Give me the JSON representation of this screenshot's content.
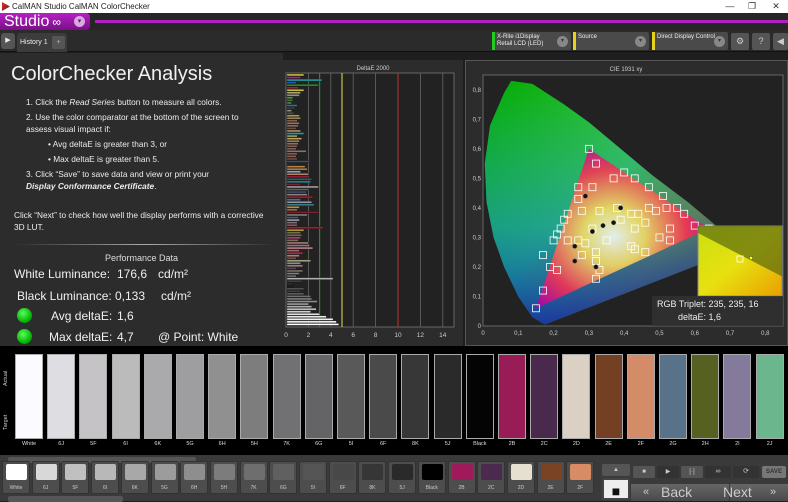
{
  "window": {
    "title": "CalMAN Studio CalMAN ColorChecker",
    "controls": [
      "—",
      "❐",
      "✕"
    ]
  },
  "studio": {
    "label": "Studio",
    "symbol": "∞",
    "dropdown": "▾"
  },
  "tabs": {
    "play": "▶",
    "history": "History 1",
    "add": "+"
  },
  "devices": [
    {
      "label": "X-Rite i1Display Retail LCD (LED)",
      "color": "#22cc22"
    },
    {
      "label": "Source",
      "color": "#e6d21a"
    },
    {
      "label": "Direct Display Control",
      "color": "#e6d21a"
    }
  ],
  "toolbar_icons": {
    "settings": "⚙",
    "help": "?",
    "back": "◀"
  },
  "analysis": {
    "title": "ColorChecker Analysis",
    "step1_pre": "1.  Click the ",
    "step1_em": "Read Series",
    "step1_post": " button to measure all colors.",
    "step2": "2.  Use the color comparator at the bottom of the screen to",
    "step2b": "assess visual impact if:",
    "bullet1": "•  Avg deltaE is greater than 3, or",
    "bullet2": "•  Max deltaE is greater than 5.",
    "step3": "3.  Click “Save” to save data and view or print your",
    "step3_em": "Display Conformance Certificate",
    "step3_end": ".",
    "next_note": "Click “Next” to check how well the display performs with a corrective",
    "next_note2": "3D LUT."
  },
  "performance": {
    "title": "Performance Data",
    "white_label": "White Luminance:",
    "white_value": "176,6",
    "white_unit": "cd/m²",
    "black_label": "Black Luminance:",
    "black_value": "0,133",
    "black_unit": "cd/m²",
    "avg_label": "Avg deltaE:",
    "avg_value": "1,6",
    "max_label": "Max deltaE:",
    "max_value": "4,7",
    "max_point": "@ Point: White"
  },
  "chart_data": [
    {
      "type": "bar",
      "title": "DeltaE 2000",
      "orientation": "horizontal",
      "xlim": [
        0,
        15
      ],
      "xticks": [
        "0",
        "2",
        "4",
        "6",
        "8",
        "10",
        "12",
        "14"
      ],
      "thresholds": [
        {
          "value": 3,
          "color": "#2a8a2a"
        },
        {
          "value": 5,
          "color": "#c8c040"
        },
        {
          "value": 10,
          "color": "#a03030"
        }
      ],
      "values": [
        1.6,
        1.3,
        3.2,
        0.9,
        2.9,
        1.1,
        1.6,
        1.3,
        1.2,
        0.6,
        0.6,
        0.5,
        1.0,
        0.8,
        0.5,
        0.7,
        1.2,
        1.3,
        1.0,
        1.2,
        1.1,
        0.9,
        1.3,
        1.6,
        1.0,
        1.4,
        1.2,
        1.1,
        1.0,
        0.9,
        1.8,
        1.0,
        0.9,
        1.0,
        2.1,
        0.9,
        1.7,
        1.9,
        1.3,
        2.0,
        2.1,
        2.3,
        2.2,
        1.3,
        2.9,
        2.0,
        1.8,
        1.9,
        2.4,
        1.3,
        2.3,
        2.5,
        1.2,
        1.0,
        2.9,
        1.9,
        1.1,
        1.2,
        1.0,
        1.0,
        3.3,
        1.6,
        1.3,
        1.4,
        1.3,
        1.1,
        2.0,
        2.1,
        2.4,
        1.2,
        1.5,
        1.2,
        0.9,
        2.2,
        1.3,
        1.5,
        0.9,
        1.5,
        1.2,
        0.9,
        4.2,
        1.4,
        0.6,
        0.7,
        1.6,
        1.3,
        1.6,
        2.2,
        2.3,
        2.8,
        2.0,
        2.3,
        2.7,
        2.2,
        3.0,
        3.6,
        4.2,
        4.5,
        4.7
      ],
      "colors": [
        "#c8c040",
        "#b02090",
        "#20a0a0",
        "#3050c0",
        "#2a8a2a",
        "#a02030",
        "#c0c040",
        "#b0a070",
        "#909090",
        "#4c9a3a",
        "#3a7a3a",
        "#707070",
        "#208080",
        "#404040",
        "#909090",
        "#505050",
        "#a0a040",
        "#a08060",
        "#806050",
        "#a07060",
        "#907060",
        "#705040",
        "#b09070",
        "#20a0a0",
        "#a0a060",
        "#c0a060",
        "#a08050",
        "#907060",
        "#806050",
        "#806050",
        "#907070",
        "#806060",
        "#906050",
        "#705040",
        "#405060",
        "#203040",
        "#c08040",
        "#a08060",
        "#a0a0a0",
        "#b08070",
        "#902030",
        "#206070",
        "#308080",
        "#802030",
        "#a0a0a0",
        "#606060",
        "#405070",
        "#908080",
        "#a02030",
        "#507090",
        "#a090a0",
        "#308090",
        "#c09030",
        "#a07040",
        "#802030",
        "#808080",
        "#406080",
        "#a0a0a0",
        "#807080",
        "#905070",
        "#a02030",
        "#a0a040",
        "#707040",
        "#806060",
        "#b04070",
        "#807060",
        "#a08070",
        "#a07080",
        "#c08090",
        "#907070",
        "#b03040",
        "#b08070",
        "#705050",
        "#a0a080",
        "#909090",
        "#a08080",
        "#505050",
        "#807070",
        "#808080",
        "#707070",
        "#b0b0b0",
        "#404040",
        "#303030",
        "#202020",
        "#505050",
        "#404040",
        "#606060",
        "#707070",
        "#808080",
        "#909090",
        "#a0a0a0",
        "#b0b0b0",
        "#c0c0c0",
        "#d0d0d0",
        "#e0e0e0",
        "#e8e8e8",
        "#f0f0f0",
        "#f8f8f8",
        "#ffffff"
      ]
    },
    {
      "type": "scatter",
      "title": "CIE 1931 xy",
      "xlim": [
        0,
        0.85
      ],
      "ylim": [
        0,
        0.85
      ],
      "xticks": [
        "0",
        "0,1",
        "0,2",
        "0,3",
        "0,4",
        "0,5",
        "0,6",
        "0,7",
        "0,8"
      ],
      "yticks": [
        "0",
        "0,1",
        "0,2",
        "0,3",
        "0,4",
        "0,5",
        "0,6",
        "0,7",
        "0,8"
      ],
      "gamut": [
        [
          0.64,
          0.33
        ],
        [
          0.3,
          0.6
        ],
        [
          0.15,
          0.06
        ]
      ],
      "targets": [
        [
          0.3,
          0.6
        ],
        [
          0.32,
          0.55
        ],
        [
          0.4,
          0.52
        ],
        [
          0.43,
          0.5
        ],
        [
          0.47,
          0.47
        ],
        [
          0.51,
          0.44
        ],
        [
          0.55,
          0.4
        ],
        [
          0.57,
          0.38
        ],
        [
          0.6,
          0.34
        ],
        [
          0.64,
          0.33
        ],
        [
          0.37,
          0.5
        ],
        [
          0.27,
          0.47
        ],
        [
          0.31,
          0.47
        ],
        [
          0.27,
          0.43
        ],
        [
          0.28,
          0.39
        ],
        [
          0.24,
          0.38
        ],
        [
          0.23,
          0.36
        ],
        [
          0.22,
          0.33
        ],
        [
          0.21,
          0.31
        ],
        [
          0.2,
          0.29
        ],
        [
          0.24,
          0.29
        ],
        [
          0.27,
          0.29
        ],
        [
          0.29,
          0.28
        ],
        [
          0.17,
          0.24
        ],
        [
          0.19,
          0.2
        ],
        [
          0.21,
          0.19
        ],
        [
          0.17,
          0.12
        ],
        [
          0.15,
          0.06
        ],
        [
          0.31,
          0.33
        ],
        [
          0.33,
          0.39
        ],
        [
          0.38,
          0.4
        ],
        [
          0.39,
          0.36
        ],
        [
          0.42,
          0.38
        ],
        [
          0.44,
          0.38
        ],
        [
          0.47,
          0.4
        ],
        [
          0.49,
          0.39
        ],
        [
          0.52,
          0.4
        ],
        [
          0.43,
          0.33
        ],
        [
          0.46,
          0.35
        ],
        [
          0.53,
          0.33
        ],
        [
          0.53,
          0.29
        ],
        [
          0.5,
          0.3
        ],
        [
          0.35,
          0.29
        ],
        [
          0.32,
          0.25
        ],
        [
          0.32,
          0.22
        ],
        [
          0.33,
          0.19
        ],
        [
          0.32,
          0.16
        ],
        [
          0.28,
          0.24
        ],
        [
          0.42,
          0.27
        ],
        [
          0.43,
          0.26
        ],
        [
          0.46,
          0.25
        ]
      ],
      "measured": [
        [
          0.31,
          0.32
        ],
        [
          0.26,
          0.27
        ],
        [
          0.39,
          0.4
        ],
        [
          0.34,
          0.34
        ],
        [
          0.37,
          0.35
        ],
        [
          0.29,
          0.44
        ],
        [
          0.26,
          0.22
        ],
        [
          0.32,
          0.2
        ]
      ],
      "inset": {
        "target": [
          0.72,
          0.22
        ],
        "measured": [
          0.75,
          0.23
        ]
      },
      "readout": {
        "rgb": "RGB Triplet: 235, 235, 16",
        "deltaE": "deltaE: 1,6"
      }
    }
  ],
  "patch_strip": {
    "actual_label": "Actual",
    "target_label": "Target",
    "patches": [
      {
        "name": "White",
        "color": "#fbfaff"
      },
      {
        "name": "6J",
        "color": "#dedde2"
      },
      {
        "name": "5F",
        "color": "#c6c3c7"
      },
      {
        "name": "6I",
        "color": "#bbbbbb"
      },
      {
        "name": "6K",
        "color": "#aaa9ab"
      },
      {
        "name": "5G",
        "color": "#9e9ea1"
      },
      {
        "name": "6H",
        "color": "#909090"
      },
      {
        "name": "5H",
        "color": "#7d7d7e"
      },
      {
        "name": "7K",
        "color": "#717173"
      },
      {
        "name": "6G",
        "color": "#646466"
      },
      {
        "name": "5I",
        "color": "#59595a"
      },
      {
        "name": "6F",
        "color": "#4a4a4b"
      },
      {
        "name": "8K",
        "color": "#373738"
      },
      {
        "name": "5J",
        "color": "#2a2a2b"
      },
      {
        "name": "Black",
        "color": "#040404"
      },
      {
        "name": "2B",
        "color": "#981c56"
      },
      {
        "name": "2C",
        "color": "#4a2a4c"
      },
      {
        "name": "2D",
        "color": "#dad0c4"
      },
      {
        "name": "2E",
        "color": "#744024"
      },
      {
        "name": "2F",
        "color": "#d48c68"
      },
      {
        "name": "2G",
        "color": "#58728a"
      },
      {
        "name": "2H",
        "color": "#566020"
      },
      {
        "name": "2I",
        "color": "#847a9c"
      },
      {
        "name": "2J",
        "color": "#6cb68e"
      }
    ]
  },
  "thumbs": [
    {
      "name": "White",
      "color": "#ffffff"
    },
    {
      "name": "6J",
      "color": "#d8d8d8"
    },
    {
      "name": "5F",
      "color": "#c0c0c0"
    },
    {
      "name": "6I",
      "color": "#b8b8b8"
    },
    {
      "name": "6K",
      "color": "#a8a8a8"
    },
    {
      "name": "5G",
      "color": "#9c9c9c"
    },
    {
      "name": "6H",
      "color": "#8e8e8e"
    },
    {
      "name": "5H",
      "color": "#7c7c7c"
    },
    {
      "name": "7K",
      "color": "#6e6e6e"
    },
    {
      "name": "6G",
      "color": "#606060"
    },
    {
      "name": "5I",
      "color": "#555555"
    },
    {
      "name": "6F",
      "color": "#484848"
    },
    {
      "name": "8K",
      "color": "#363636"
    },
    {
      "name": "5J",
      "color": "#2a2a2a"
    },
    {
      "name": "Black",
      "color": "#000000"
    },
    {
      "name": "2B",
      "color": "#9e1a5a"
    },
    {
      "name": "2C",
      "color": "#4c2a50"
    },
    {
      "name": "2D",
      "color": "#e6e0d0"
    },
    {
      "name": "2E",
      "color": "#7a4424"
    },
    {
      "name": "2F",
      "color": "#d88c66"
    }
  ],
  "controls": {
    "up": "▲",
    "stop": "■",
    "play": "▶",
    "bracket": "[·]",
    "loop": "∞",
    "refresh": "⟳",
    "save": "SAVE",
    "back": "Back",
    "back_icon": "«",
    "next": "Next",
    "next_icon": "»",
    "scroll_left": "◀",
    "scroll_right": "▶"
  }
}
